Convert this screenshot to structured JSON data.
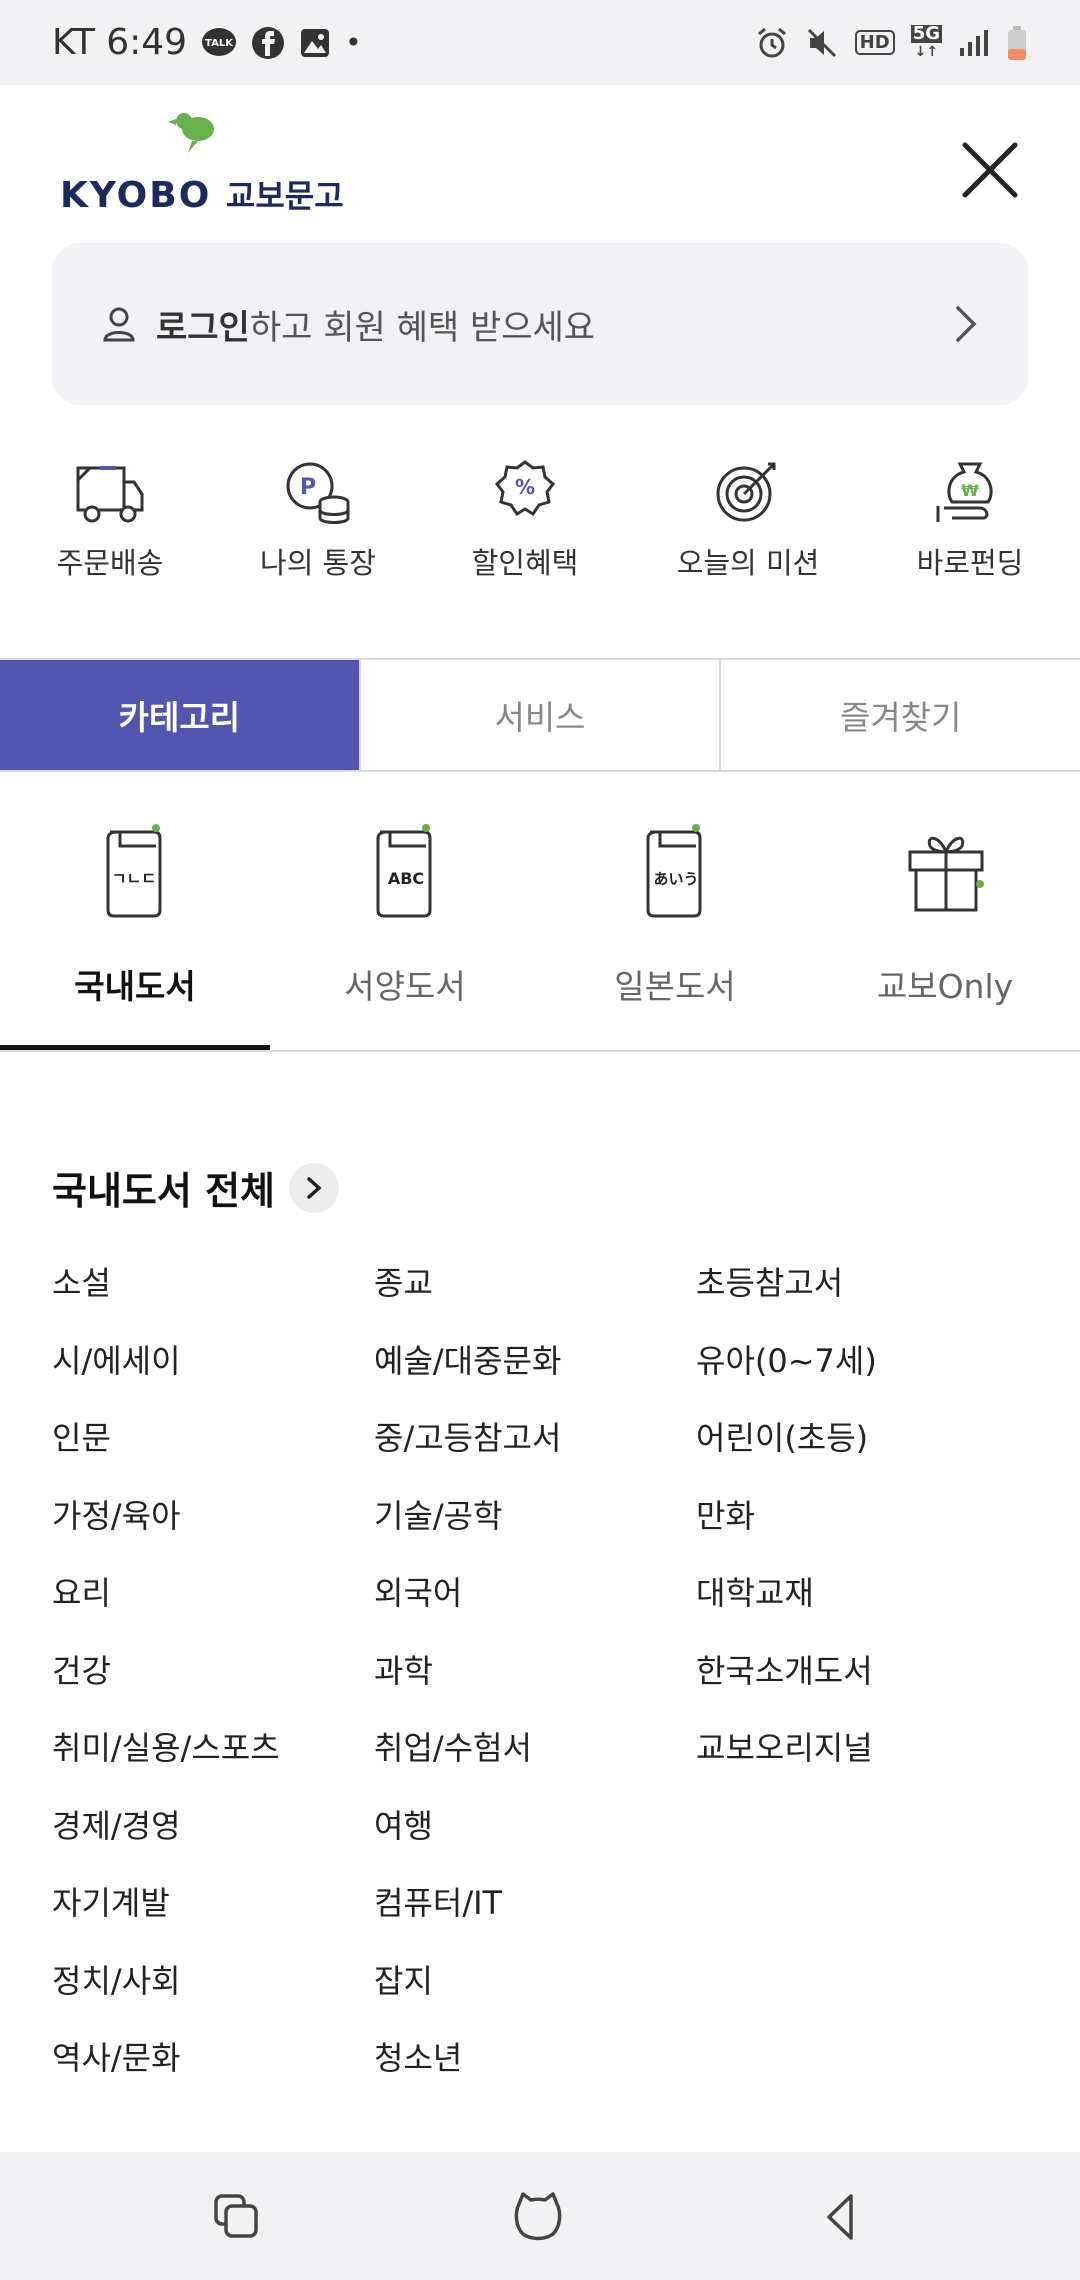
{
  "status_bar": {
    "carrier_time": "KT 6:49",
    "talk_badge": "TALK",
    "hd": "HD",
    "network": "5G",
    "dot": "•"
  },
  "header": {
    "logo_en": "KYOBO",
    "logo_ko": "교보문고"
  },
  "login": {
    "bold": "로그인",
    "rest": "하고 회원 혜택 받으세요"
  },
  "quick_menu": [
    {
      "label": "주문배송",
      "icon": "delivery-truck-icon"
    },
    {
      "label": "나의 통장",
      "icon": "points-coins-icon"
    },
    {
      "label": "할인혜택",
      "icon": "discount-badge-icon"
    },
    {
      "label": "오늘의 미션",
      "icon": "target-icon"
    },
    {
      "label": "바로펀딩",
      "icon": "funding-money-icon"
    }
  ],
  "tabs": [
    {
      "label": "카테고리",
      "active": true
    },
    {
      "label": "서비스",
      "active": false
    },
    {
      "label": "즐겨찾기",
      "active": false
    }
  ],
  "subcategories": [
    {
      "label": "국내도서",
      "icon_text": "ㄱㄴㄷ",
      "active": true
    },
    {
      "label": "서양도서",
      "icon_text": "ABC",
      "active": false
    },
    {
      "label": "일본도서",
      "icon_text": "あいう",
      "active": false
    },
    {
      "label": "교보Only",
      "icon": "gift-icon",
      "active": false
    }
  ],
  "section": {
    "title": "국내도서 전체"
  },
  "categories": {
    "col1": [
      "소설",
      "시/에세이",
      "인문",
      "가정/육아",
      "요리",
      "건강",
      "취미/실용/스포츠",
      "경제/경영",
      "자기계발",
      "정치/사회",
      "역사/문화"
    ],
    "col2": [
      "종교",
      "예술/대중문화",
      "중/고등참고서",
      "기술/공학",
      "외국어",
      "과학",
      "취업/수험서",
      "여행",
      "컴퓨터/IT",
      "잡지",
      "청소년"
    ],
    "col3": [
      "초등참고서",
      "유아(0~7세)",
      "어린이(초등)",
      "만화",
      "대학교재",
      "한국소개도서",
      "교보오리지널"
    ]
  },
  "colors": {
    "accent": "#5155ad",
    "logo_navy": "#1c2a5e",
    "logo_green": "#6ab04c",
    "banner_bg": "#f1f1f6"
  }
}
